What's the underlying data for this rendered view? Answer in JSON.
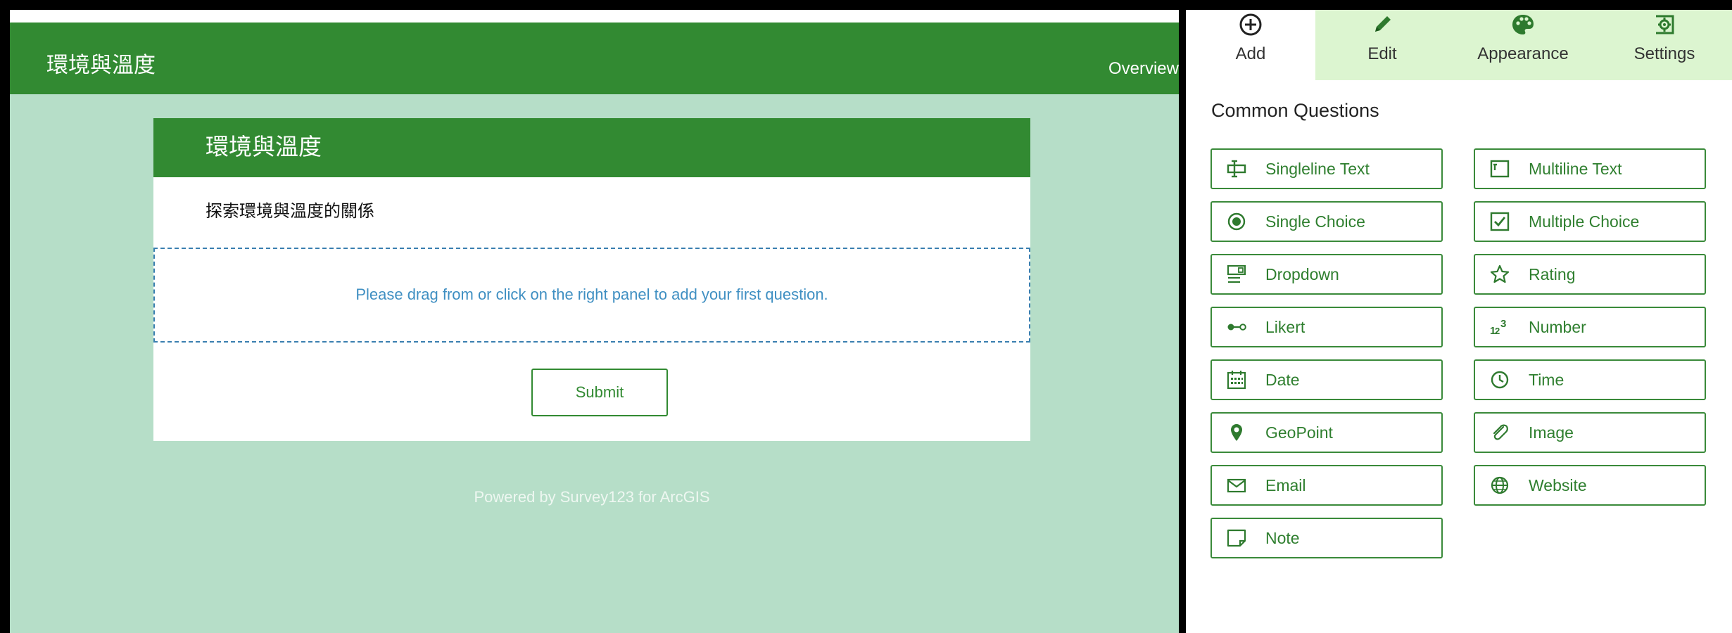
{
  "app": {
    "title": "環境與溫度",
    "nav_overview": "Overview"
  },
  "survey": {
    "title": "環境與溫度",
    "description": "探索環境與溫度的關係",
    "drop_hint": "Please drag from or click on the right panel to add your first question.",
    "submit_label": "Submit",
    "powered_by": "Powered by Survey123 for ArcGIS"
  },
  "panel": {
    "tabs": [
      {
        "label": "Add",
        "icon": "plus-circle-icon",
        "active": true
      },
      {
        "label": "Edit",
        "icon": "pencil-icon",
        "active": false
      },
      {
        "label": "Appearance",
        "icon": "palette-icon",
        "active": false
      },
      {
        "label": "Settings",
        "icon": "settings-gear-icon",
        "active": false
      }
    ],
    "heading": "Common Questions",
    "questions": [
      {
        "label": "Singleline Text",
        "icon": "singleline-text-icon"
      },
      {
        "label": "Multiline Text",
        "icon": "multiline-text-icon"
      },
      {
        "label": "Single Choice",
        "icon": "radio-icon"
      },
      {
        "label": "Multiple Choice",
        "icon": "checkbox-icon"
      },
      {
        "label": "Dropdown",
        "icon": "dropdown-icon"
      },
      {
        "label": "Rating",
        "icon": "star-icon"
      },
      {
        "label": "Likert",
        "icon": "likert-icon"
      },
      {
        "label": "Number",
        "icon": "number-icon"
      },
      {
        "label": "Date",
        "icon": "calendar-icon"
      },
      {
        "label": "Time",
        "icon": "clock-icon"
      },
      {
        "label": "GeoPoint",
        "icon": "map-pin-icon"
      },
      {
        "label": "Image",
        "icon": "paperclip-icon"
      },
      {
        "label": "Email",
        "icon": "envelope-icon"
      },
      {
        "label": "Website",
        "icon": "globe-icon"
      },
      {
        "label": "Note",
        "icon": "note-icon"
      }
    ]
  },
  "colors": {
    "brand_green": "#328a32",
    "background_mint": "#b6dec8",
    "tab_bar": "#dcf5d0",
    "hint_blue": "#3f8fc2"
  }
}
